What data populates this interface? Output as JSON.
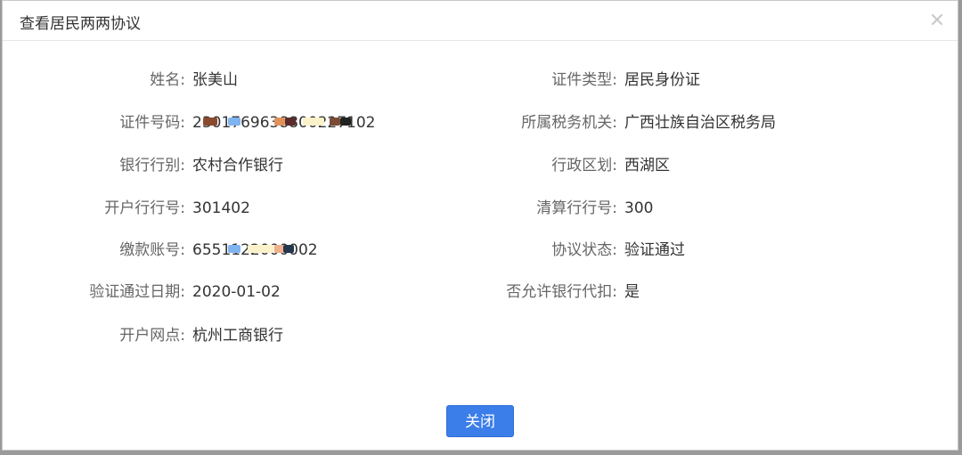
{
  "dialog": {
    "title": "查看居民两两协议",
    "close_button_label": "关闭"
  },
  "fields": {
    "name": {
      "label": "姓名:",
      "value": "张美山"
    },
    "id_type": {
      "label": "证件类型:",
      "value": "居民身份证"
    },
    "id_number": {
      "label": "证件号码:",
      "value": "2301769638800227102"
    },
    "tax_office": {
      "label": "所属税务机关:",
      "value": "广西壮族自治区税务局"
    },
    "bank_type": {
      "label": "银行行别:",
      "value": "农村合作银行"
    },
    "admin_area": {
      "label": "行政区划:",
      "value": "西湖区"
    },
    "bank_code": {
      "label": "开户行行号:",
      "value": "301402"
    },
    "clearing_code": {
      "label": "清算行行号:",
      "value": "300"
    },
    "account_no": {
      "label": "缴款账号:",
      "value": "6551122000002"
    },
    "agreement_status": {
      "label": "协议状态:",
      "value": "验证通过"
    },
    "verify_date": {
      "label": "验证通过日期:",
      "value": "2020-01-02"
    },
    "allow_deduction": {
      "label": "否允许银行代扣:",
      "value": "是"
    },
    "branch": {
      "label": "开户网点:",
      "value": "杭州工商银行"
    }
  },
  "colors": {
    "primary_button": "#3b7de9",
    "label_text": "#666666",
    "value_text": "#333333",
    "overlay": "#9a9a9a"
  }
}
